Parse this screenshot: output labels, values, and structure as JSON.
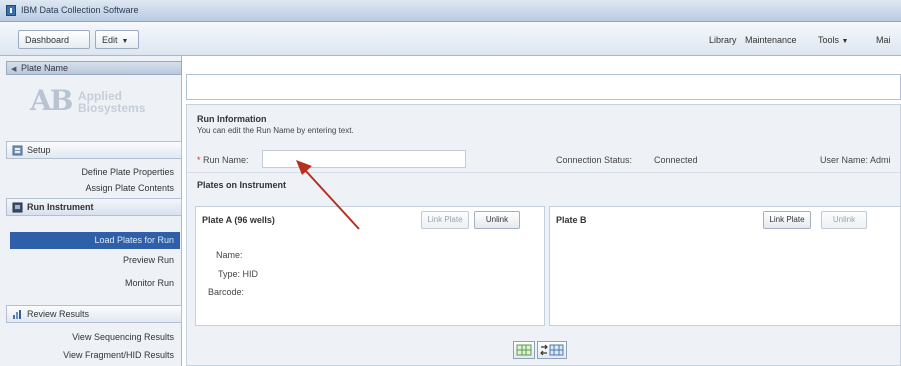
{
  "window": {
    "title": "IBM Data Collection Software"
  },
  "menubar": {
    "dashboard_label": "Dashboard",
    "edit_label": "Edit",
    "right_menu": [
      "Library",
      "Maintenance",
      "Tools",
      "Mai"
    ]
  },
  "sidebar": {
    "plate_name_label": "Plate Name",
    "logo": {
      "mark": "AB",
      "line1": "Applied",
      "line2": "Biosystems"
    },
    "sections": [
      {
        "label": "Setup",
        "icon": "setup-icon",
        "items": [
          "Define Plate Properties",
          "Assign Plate Contents"
        ]
      },
      {
        "label": "Run Instrument",
        "icon": "run-instrument-icon",
        "items": [
          "Load Plates for Run",
          "Preview Run",
          "Monitor Run"
        ]
      },
      {
        "label": "Review Results",
        "icon": "review-results-icon",
        "items": [
          "View Sequencing Results",
          "View Fragment/HID Results"
        ]
      }
    ],
    "selected_item": "Load Plates for Run"
  },
  "main": {
    "run_info": {
      "title": "Run Information",
      "hint": "You can edit the Run Name by entering text.",
      "run_name_label": "Run Name:",
      "run_name_value": "",
      "connection_label": "Connection Status:",
      "connection_value": "Connected",
      "user_label": "User Name:",
      "user_value": "Admi"
    },
    "plates_title": "Plates on Instrument",
    "plate_a": {
      "title": "Plate A (96 wells)",
      "link_label": "Link Plate",
      "unlink_label": "Unlink",
      "name_label": "Name:",
      "type_label": "Type: HID",
      "barcode_label": "Barcode:"
    },
    "plate_b": {
      "title": "Plate B",
      "link_label": "Link Plate",
      "unlink_label": "Unlink"
    }
  },
  "colors": {
    "selected_nav": "#2f5fa8",
    "annotation_arrow": "#b5301f",
    "panel_bg": "#eef2f7"
  }
}
